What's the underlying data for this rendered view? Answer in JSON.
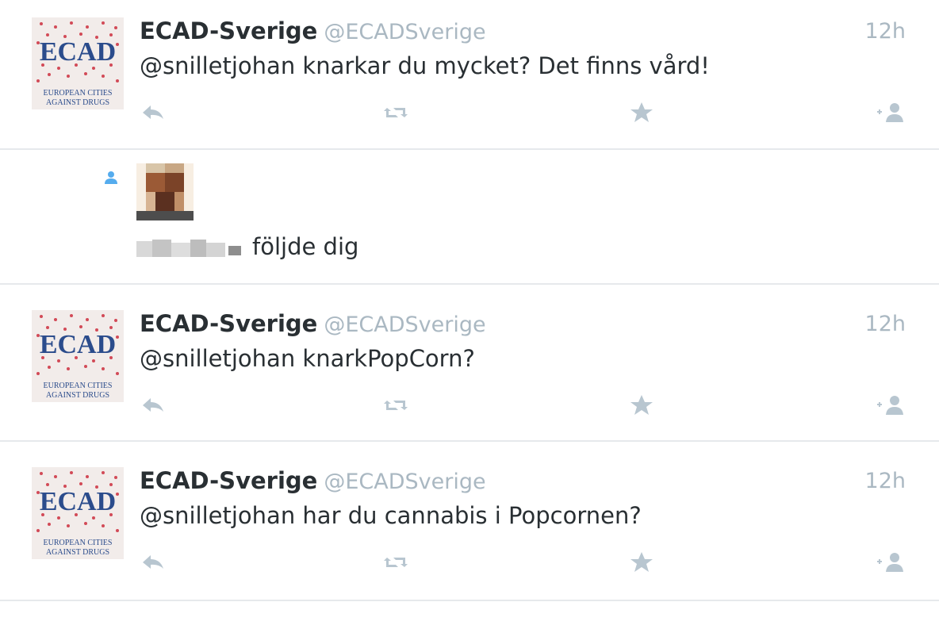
{
  "tweets": [
    {
      "name": "ECAD-Sverige",
      "handle": "@ECADSverige",
      "time": "12h",
      "text": "@snilletjohan knarkar du mycket? Det finns vård!"
    },
    {
      "name": "ECAD-Sverige",
      "handle": "@ECADSverige",
      "time": "12h",
      "text": "@snilletjohan knarkPopCorn?"
    },
    {
      "name": "ECAD-Sverige",
      "handle": "@ECADSverige",
      "time": "12h",
      "text": "@snilletjohan har du cannabis i Popcornen?"
    }
  ],
  "follow_notice": {
    "text": "följde dig",
    "icon": "person-icon"
  },
  "avatar_logo": {
    "title": "ECAD",
    "line1": "EUROPEAN CITIES",
    "line2": "AGAINST DRUGS"
  },
  "icons": {
    "reply": "reply-icon",
    "retweet": "retweet-icon",
    "favorite": "star-icon",
    "follow": "follow-icon"
  },
  "colors": {
    "name": "#292f33",
    "muted": "#aab8c2",
    "icon": "#b8c6d0",
    "accent": "#55acee",
    "logo_blue": "#2b4c8c",
    "logo_dots": "#d24a57",
    "divider": "#e6e9ec"
  }
}
